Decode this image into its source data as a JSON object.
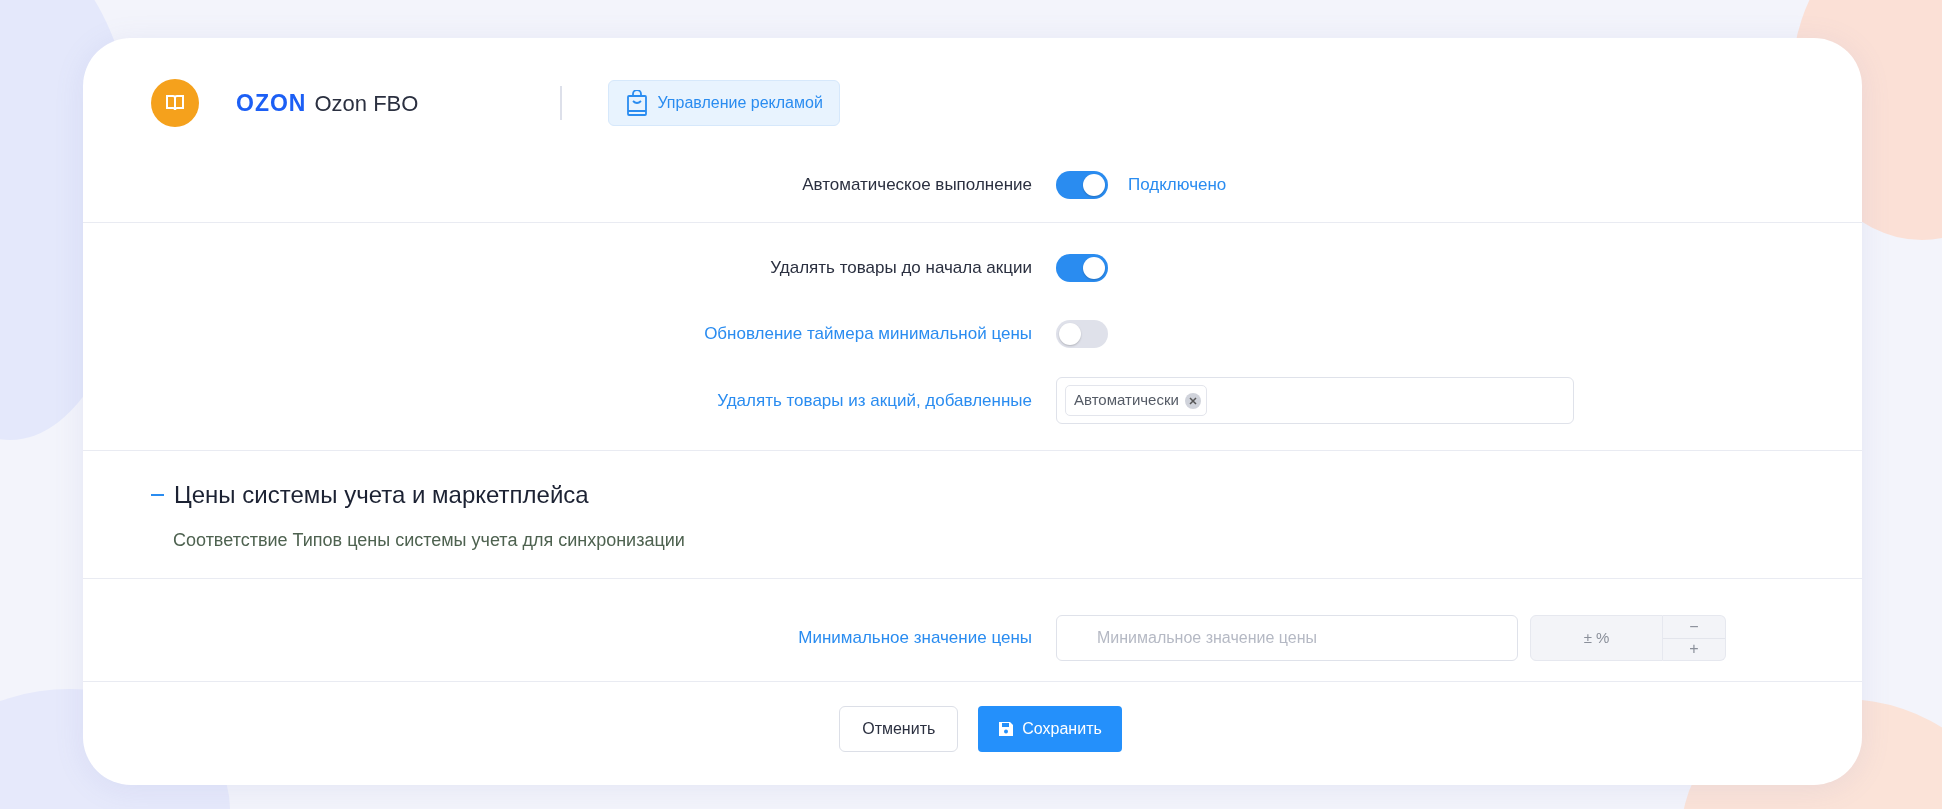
{
  "header": {
    "brand": "OZON",
    "title": "Ozon FBO",
    "ad_button": "Управление рекламой"
  },
  "auto_row": {
    "label": "Автоматическое выполнение",
    "on": true,
    "status": "Подключено"
  },
  "settings": [
    {
      "kind": "toggle",
      "label": "Удалять товары до начала акции",
      "link": false,
      "on": true
    },
    {
      "kind": "toggle",
      "label": "Обновление таймера минимальной цены",
      "link": true,
      "on": false
    },
    {
      "kind": "multiselect",
      "label": "Удалять товары из акций, добавленные",
      "link": true,
      "tags": [
        "Автоматически"
      ]
    }
  ],
  "section": {
    "title": "Цены системы учета и маркетплейса",
    "expanded": true,
    "subtitle": "Соответствие Типов цены системы учета для синхронизации"
  },
  "price_row": {
    "label": "Минимальное значение цены",
    "placeholder": "Минимальное значение цены",
    "addon": "± %",
    "decrement": "−",
    "increment": "+"
  },
  "buttons": [
    {
      "kind": "secondary",
      "label": "Отменить"
    },
    {
      "kind": "primary",
      "label": "Сохранить"
    }
  ]
}
